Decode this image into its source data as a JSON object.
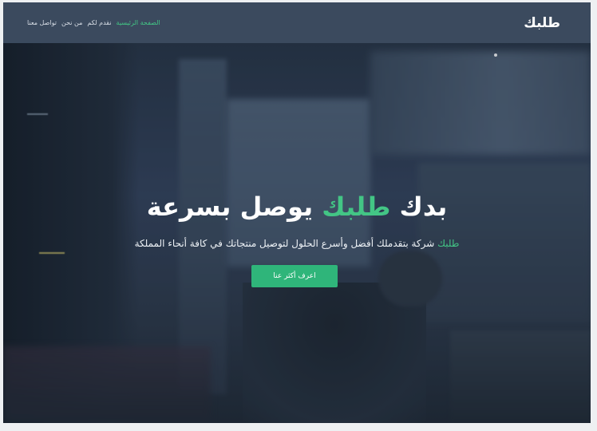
{
  "header": {
    "logo": "طلبك",
    "nav_links": [
      {
        "label": "الصفحة الرئيسية",
        "active": true
      },
      {
        "label": "نقدم لكم",
        "active": false
      },
      {
        "label": "من نحن",
        "active": false
      },
      {
        "label": "تواصل معنا",
        "active": false
      }
    ]
  },
  "hero": {
    "title_prefix": "بدك",
    "title_accent": "طلبك",
    "title_suffix": "يوصل بسرعة",
    "subtitle_accent": "طلبك",
    "subtitle_rest": "شركة بتقدملك أفضل وأسرع الحلول لتوصيل منتجاتك في كافة أنحاء المملكة",
    "cta_label": "اعرف أكثر عنا"
  },
  "colors": {
    "accent": "#43c585",
    "navbar": "#3b4a5e",
    "button": "#2fb57a"
  }
}
